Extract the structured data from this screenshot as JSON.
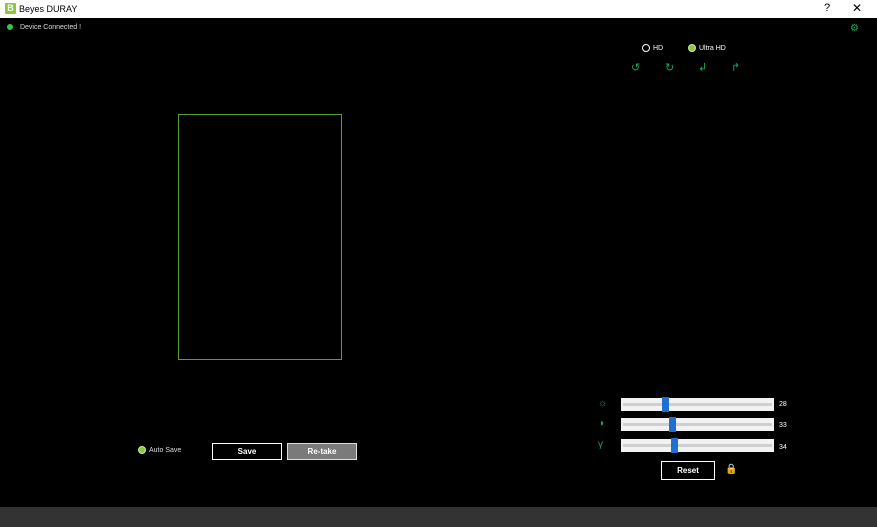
{
  "window": {
    "logo_letter": "B",
    "title": "Beyes DURAY",
    "help_label": "?",
    "close_label": "✕"
  },
  "status": {
    "text": "Device Connected !",
    "color": "#2ecc40"
  },
  "settings_icon": "⚙",
  "resolution": {
    "options": [
      {
        "label": "HD",
        "selected": false
      },
      {
        "label": "Ultra HD",
        "selected": true
      }
    ]
  },
  "rotation_icons": [
    "↺",
    "↻",
    "↲",
    "↱"
  ],
  "auto_save": {
    "label": "Auto Save",
    "checked": true
  },
  "buttons": {
    "save": "Save",
    "retake": "Re-take",
    "reset": "Reset"
  },
  "adjustments": [
    {
      "icon": "☼",
      "name": "brightness",
      "value": "28",
      "fraction": 0.28
    },
    {
      "icon": "◑",
      "name": "contrast",
      "value": "33",
      "fraction": 0.33
    },
    {
      "icon": "γ",
      "name": "gamma",
      "value": "34",
      "fraction": 0.34
    }
  ],
  "lock_icon": "🔒",
  "colors": {
    "accent_green": "#8dc63f",
    "icon_green": "#19a35a",
    "slider_thumb": "#1f6fd0"
  }
}
